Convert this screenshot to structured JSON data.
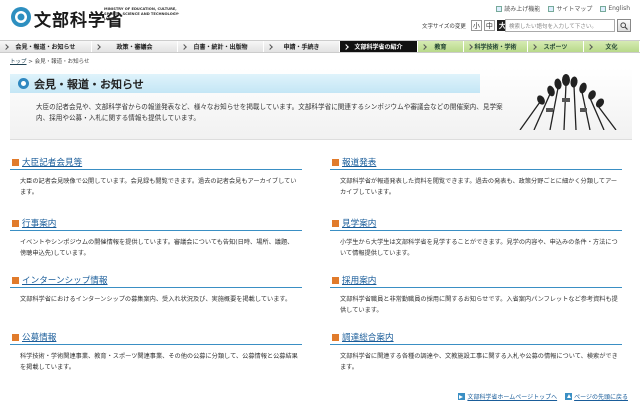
{
  "header": {
    "logo_text": "文部科学省",
    "logo_sub": "MINISTRY OF EDUCATION, CULTURE, SPORTS, SCIENCE AND TECHNOLOGY-JAPAN",
    "top_links": [
      "読み上げ機能",
      "サイトマップ",
      "English"
    ],
    "text_size_label": "文字サイズの変更",
    "text_sizes": [
      "小",
      "中",
      "大"
    ],
    "search_placeholder": "検索したい語句を入力して下さい。"
  },
  "nav": [
    {
      "label": "会見・報道・お知らせ",
      "state": "normal"
    },
    {
      "label": "政策・審議会",
      "state": "normal"
    },
    {
      "label": "白書・統計・出版物",
      "state": "normal"
    },
    {
      "label": "申請・手続き",
      "state": "normal"
    },
    {
      "label": "文部科学省の紹介",
      "state": "current"
    },
    {
      "label": "教育",
      "state": "green"
    },
    {
      "label": "科学技術・学術",
      "state": "green"
    },
    {
      "label": "スポーツ",
      "state": "green"
    },
    {
      "label": "文化",
      "state": "green"
    }
  ],
  "breadcrumb": {
    "home": "トップ",
    "sep": " > ",
    "current": "会見・報道・お知らせ"
  },
  "page": {
    "title": "会見・報道・お知らせ",
    "intro": "大臣の記者会見や、文部科学省からの報道発表など、様々なお知らせを掲載しています。文部科学省に関連するシンポジウムや審議会などの開催案内、見学案内、採用や公募・入札に関する情報も提供しています。"
  },
  "cards": [
    {
      "title": "大臣記者会見等",
      "desc": "大臣の記者会見映像で公開しています。会見録も閲覧できます。過去の記者会見もアーカイブしています。"
    },
    {
      "title": "報道発表",
      "desc": "文部科学省が報道発表した資料を閲覧できます。過去の発表も、政策分野ごとに細かく分類してアーカイブしています。"
    },
    {
      "title": "行事案内",
      "desc": "イベントやシンポジウムの開催情報を提供しています。審議会についても告知(日時、場所、議題、傍聴申込先)しています。"
    },
    {
      "title": "見学案内",
      "desc": "小学生から大学生は文部科学省を見学することができます。見学の内容や、申込みの条件・方法について情報提供しています。"
    },
    {
      "title": "インターンシップ情報",
      "desc": "文部科学省におけるインターンシップの募集案内、受入れ状況及び、実施概要を掲載しています。"
    },
    {
      "title": "採用案内",
      "desc": "文部科学省職員と非常勤職員の採用に関するお知らせです。入省案内パンフレットなど参考資料も提供しています。"
    },
    {
      "title": "公募情報",
      "desc": "科学技術・学術関連事業、教育・スポーツ関連事業、その他の公募に分類して、公募情報と公募結果を掲載しています。"
    },
    {
      "title": "調達総合案内",
      "desc": "文部科学省に関連する各種の調達や、文教施設工事に関する入札や公募の情報について、検索ができます。"
    }
  ],
  "footer": {
    "home_link": "文部科学省ホームページトップへ",
    "top_link": "ページの先頭に戻る"
  }
}
